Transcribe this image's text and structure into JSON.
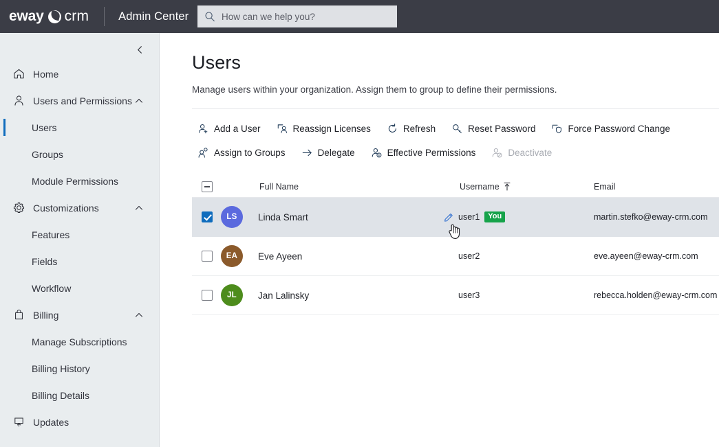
{
  "topbar": {
    "logo_primary": "eway",
    "logo_secondary": "crm",
    "logo_mark_icon": "eway-circle-mark",
    "app_title": "Admin Center",
    "search_icon": "search-icon",
    "search_placeholder": "How can we help you?",
    "search_value": "",
    "background": "#3b3d46"
  },
  "sidebar": {
    "collapse_icon": "chevron-left-icon",
    "background": "#e9edef",
    "active_accent": "#0f6cbd",
    "items": [
      {
        "label": "Home",
        "icon": "home-icon",
        "level": "top",
        "expandable": false,
        "active": false
      },
      {
        "label": "Users and Permissions",
        "icon": "person-icon",
        "level": "top",
        "expandable": true,
        "chevron": "chevron-up-icon",
        "active": false
      },
      {
        "label": "Users",
        "icon": "",
        "level": "child",
        "expandable": false,
        "active": true
      },
      {
        "label": "Groups",
        "icon": "",
        "level": "child",
        "expandable": false,
        "active": false
      },
      {
        "label": "Module Permissions",
        "icon": "",
        "level": "child",
        "expandable": false,
        "active": false
      },
      {
        "label": "Customizations",
        "icon": "gear-icon",
        "level": "top",
        "expandable": true,
        "chevron": "chevron-up-icon",
        "active": false
      },
      {
        "label": "Features",
        "icon": "",
        "level": "child",
        "expandable": false,
        "active": false
      },
      {
        "label": "Fields",
        "icon": "",
        "level": "child",
        "expandable": false,
        "active": false
      },
      {
        "label": "Workflow",
        "icon": "",
        "level": "child",
        "expandable": false,
        "active": false
      },
      {
        "label": "Billing",
        "icon": "bag-icon",
        "level": "top",
        "expandable": true,
        "chevron": "chevron-up-icon",
        "active": false
      },
      {
        "label": "Manage Subscriptions",
        "icon": "",
        "level": "child",
        "expandable": false,
        "active": false
      },
      {
        "label": "Billing History",
        "icon": "",
        "level": "child",
        "expandable": false,
        "active": false
      },
      {
        "label": "Billing Details",
        "icon": "",
        "level": "child",
        "expandable": false,
        "active": false
      },
      {
        "label": "Updates",
        "icon": "update-icon",
        "level": "top",
        "expandable": false,
        "active": false
      }
    ]
  },
  "page": {
    "title": "Users",
    "subtitle": "Manage users within your organization. Assign them to group to define their permissions."
  },
  "toolbar": {
    "buttons": [
      {
        "label": "Add a User",
        "icon": "person-add-icon",
        "disabled": false
      },
      {
        "label": "Reassign Licenses",
        "icon": "reassign-license-icon",
        "disabled": false
      },
      {
        "label": "Refresh",
        "icon": "refresh-icon",
        "disabled": false
      },
      {
        "label": "Reset Password",
        "icon": "key-icon",
        "disabled": false
      },
      {
        "label": "Force Password Change",
        "icon": "force-password-icon",
        "disabled": false
      },
      {
        "label": "Assign to Groups",
        "icon": "person-group-icon",
        "disabled": false
      },
      {
        "label": "Delegate",
        "icon": "arrow-right-icon",
        "disabled": false
      },
      {
        "label": "Effective Permissions",
        "icon": "person-info-icon",
        "disabled": false
      },
      {
        "label": "Deactivate",
        "icon": "person-block-icon",
        "disabled": true
      }
    ]
  },
  "table": {
    "select_all_state": "indeterminate",
    "columns": [
      {
        "label": "Full Name",
        "sorted": false
      },
      {
        "label": "Username",
        "sorted": true,
        "sort_icon": "sort-ascending-icon"
      },
      {
        "label": "Email",
        "sorted": false
      }
    ],
    "rows": [
      {
        "selected": true,
        "initials": "LS",
        "avatar_color": "#5b6ade",
        "full_name": "Linda Smart",
        "username": "user1",
        "badge": "You",
        "badge_color": "#16a34a",
        "edit_icon": "pencil-edit-icon",
        "email": "martin.stefko@eway-crm.com"
      },
      {
        "selected": false,
        "initials": "EA",
        "avatar_color": "#8b5a2b",
        "full_name": "Eve Ayeen",
        "username": "user2",
        "badge": "",
        "email": "eve.ayeen@eway-crm.com"
      },
      {
        "selected": false,
        "initials": "JL",
        "avatar_color": "#4d8c1c",
        "full_name": "Jan Lalinsky",
        "username": "user3",
        "badge": "",
        "email": "rebecca.holden@eway-crm.com"
      }
    ]
  },
  "cursor": {
    "type": "pointing-hand-cursor"
  }
}
